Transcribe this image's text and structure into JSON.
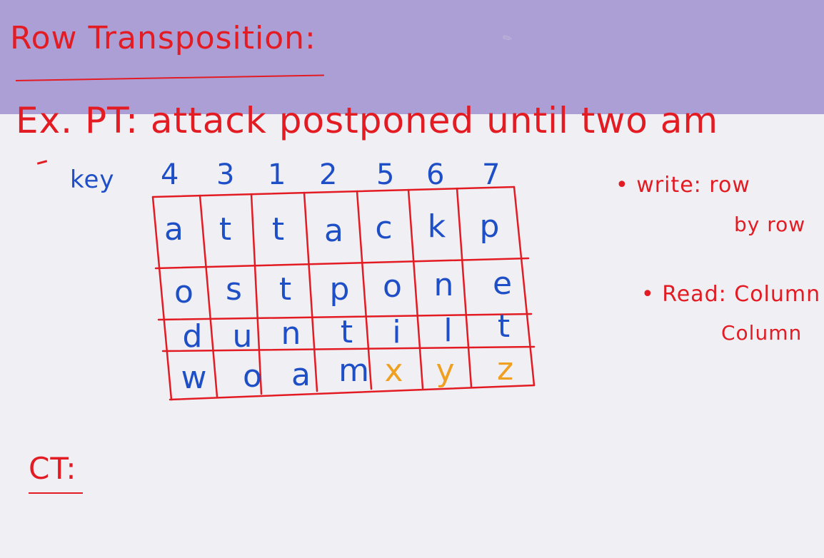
{
  "title": "Row Transposition:",
  "example": "Ex. PT: attack postponed until two am",
  "key": {
    "label": "key",
    "digits": [
      "4",
      "3",
      "1",
      "2",
      "5",
      "6",
      "7"
    ]
  },
  "grid": {
    "rows": [
      [
        "a",
        "t",
        "t",
        "a",
        "c",
        "k",
        "p"
      ],
      [
        "o",
        "s",
        "t",
        "p",
        "o",
        "n",
        "e"
      ],
      [
        "d",
        "u",
        "n",
        "t",
        "i",
        "l",
        "t"
      ],
      [
        "w",
        "o",
        "a",
        "m",
        "x",
        "y",
        "z"
      ]
    ],
    "padding_letters": [
      "x",
      "y",
      "z"
    ]
  },
  "notes": {
    "write_line1": "• write: row",
    "write_line2": "by row",
    "read_line1": "• Read: Column by",
    "read_line2": "Column"
  },
  "ct_label": "CT:",
  "colors": {
    "header_bg": "#ac9fd6",
    "paper_bg": "#efeff4",
    "ink_red": "#e31b23",
    "ink_blue": "#1f4fc6",
    "ink_orange": "#f0a020"
  },
  "icons": {
    "pen": "pencil-cursor-icon"
  }
}
